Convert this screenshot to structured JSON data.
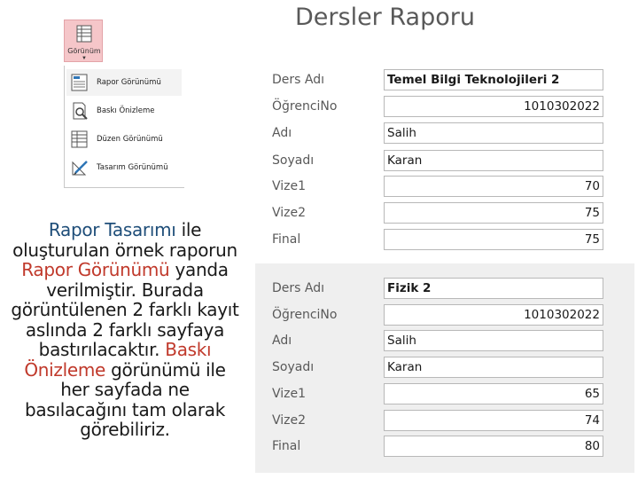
{
  "view_menu": {
    "button_label": "Görünüm",
    "items": [
      {
        "label": "Rapor Görünümü",
        "icon": "report-view-icon"
      },
      {
        "label": "Baskı Önizleme",
        "icon": "print-preview-icon"
      },
      {
        "label": "Düzen Görünümü",
        "icon": "layout-view-icon"
      },
      {
        "label": "Tasarım Görünümü",
        "icon": "design-view-icon"
      }
    ]
  },
  "caption": {
    "part1": "Rapor Tasarımı",
    "part2": " ile oluşturulan örnek raporun ",
    "part3": "Rapor Görünümü",
    "part4": " yanda verilmiştir. Burada görüntülenen 2 farklı kayıt aslında 2 farklı sayfaya bastırılacaktır. ",
    "part5": "Baskı Önizleme",
    "part6": " görünümü ile her sayfada ne basılacağını tam olarak görebiliriz."
  },
  "report": {
    "title": "Dersler Raporu",
    "records": [
      {
        "fields": [
          {
            "label": "Ders Adı",
            "value": "Temel Bilgi Teknolojileri 2"
          },
          {
            "label": "ÖğrenciNo",
            "value": "1010302022"
          },
          {
            "label": "Adı",
            "value": "Salih"
          },
          {
            "label": "Soyadı",
            "value": "Karan"
          },
          {
            "label": "Vize1",
            "value": "70"
          },
          {
            "label": "Vize2",
            "value": "75"
          },
          {
            "label": "Final",
            "value": "75"
          }
        ]
      },
      {
        "fields": [
          {
            "label": "Ders Adı",
            "value": "Fizik 2"
          },
          {
            "label": "ÖğrenciNo",
            "value": "1010302022"
          },
          {
            "label": "Adı",
            "value": "Salih"
          },
          {
            "label": "Soyadı",
            "value": "Karan"
          },
          {
            "label": "Vize1",
            "value": "65"
          },
          {
            "label": "Vize2",
            "value": "74"
          },
          {
            "label": "Final",
            "value": "80"
          }
        ]
      }
    ]
  }
}
